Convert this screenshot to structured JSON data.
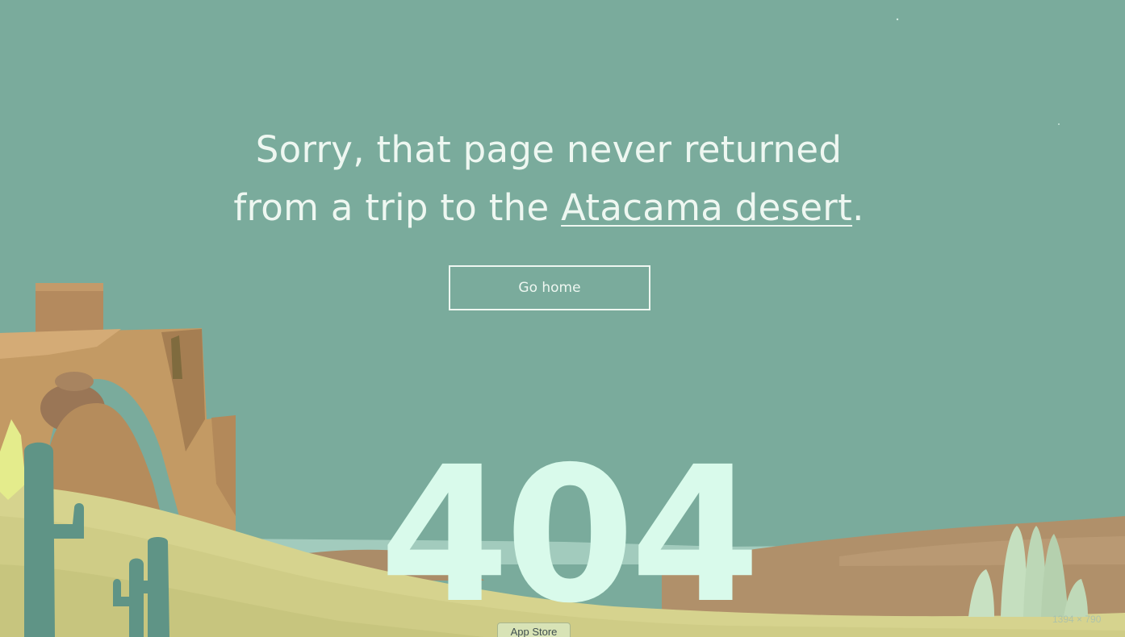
{
  "message": {
    "line1": "Sorry, that page never returned",
    "line2_prefix": "from a trip to the ",
    "link_text": "Atacama desert",
    "line2_suffix": "."
  },
  "home_button": {
    "label": "Go home"
  },
  "error_code": "404",
  "dock_tooltip": "App Store",
  "window_size_readout": "1394 × 790",
  "colors": {
    "background": "#7aab9c",
    "text": "#eef7f1",
    "error_code": "#d9faeb",
    "sand_light": "#d6d38e",
    "sand_dark": "#b0906a",
    "rock": "#c39a64",
    "cactus": "#5f9486"
  },
  "icons": [
    "cactus-icon",
    "rock-arch-illustration",
    "salt-spires-illustration"
  ]
}
